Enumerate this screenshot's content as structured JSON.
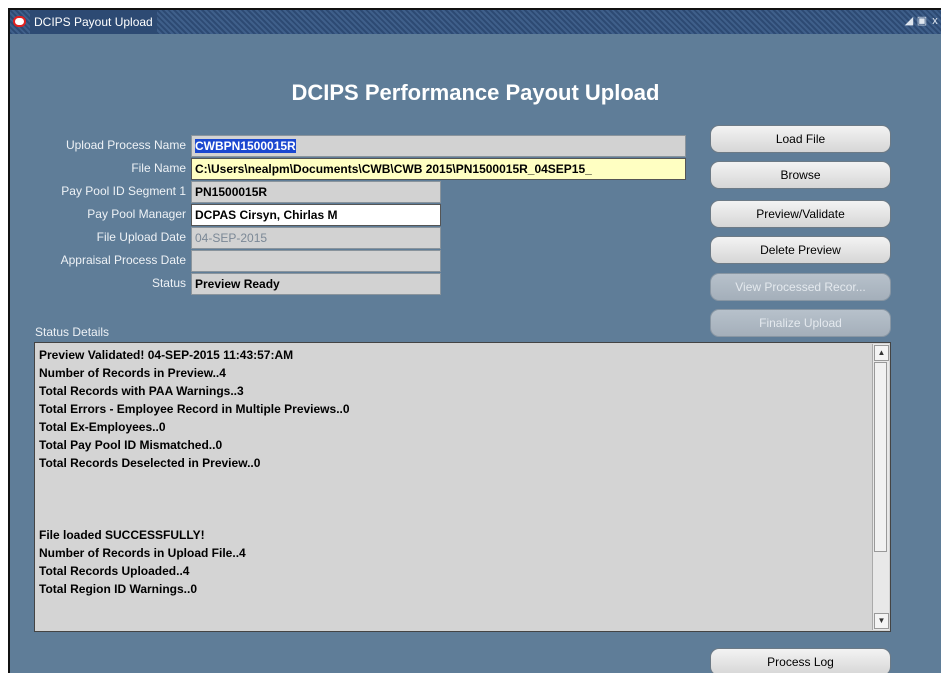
{
  "window": {
    "title": "DCIPS Payout Upload",
    "controls": [
      "◢",
      "▣",
      "x"
    ]
  },
  "heading": "DCIPS Performance Payout Upload",
  "fields": {
    "upload_process_name": {
      "label": "Upload Process Name",
      "value": "CWBPN1500015R"
    },
    "file_name": {
      "label": "File Name",
      "value": "C:\\Users\\nealpm\\Documents\\CWB\\CWB 2015\\PN1500015R_04SEP15_"
    },
    "pay_pool_id_segment_1": {
      "label": "Pay Pool ID Segment 1",
      "value": "PN1500015R"
    },
    "pay_pool_manager": {
      "label": "Pay Pool Manager",
      "value": "DCPAS Cirsyn, Chirlas M"
    },
    "file_upload_date": {
      "label": "File Upload Date",
      "value": "04-SEP-2015"
    },
    "appraisal_process_date": {
      "label": "Appraisal Process Date",
      "value": ""
    },
    "status": {
      "label": "Status",
      "value": "Preview Ready"
    }
  },
  "buttons": {
    "load_file": "Load File",
    "browse": "Browse",
    "preview_validate": "Preview/Validate",
    "delete_preview": "Delete Preview",
    "view_processed": "View Processed Recor...",
    "finalize_upload": "Finalize Upload",
    "process_log": "Process Log"
  },
  "status_details": {
    "label": "Status Details",
    "lines": [
      "Preview Validated! 04-SEP-2015 11:43:57:AM",
      "Number of Records in Preview..4",
      "Total Records with PAA Warnings..3",
      "Total Errors - Employee Record in Multiple Previews..0",
      "Total Ex-Employees..0",
      "Total Pay Pool ID Mismatched..0",
      "Total Records Deselected in Preview..0",
      "",
      "",
      "",
      "File loaded SUCCESSFULLY!",
      "Number of Records in Upload File..4",
      "Total Records Uploaded..4",
      "Total Region ID Warnings..0"
    ]
  },
  "colors": {
    "window_bg": "#5f7d98",
    "titlebar_bg": "#2d4a73",
    "selection": "#1a47d0",
    "file_name_field_bg": "#ffffc2"
  }
}
